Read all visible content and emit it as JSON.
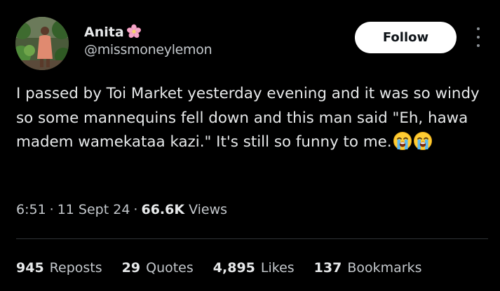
{
  "author": {
    "display_name": "Anita",
    "name_icon": "pink-flower-icon",
    "handle": "@missmoneylemon",
    "avatar_icon": "profile-photo"
  },
  "actions": {
    "follow_label": "Follow",
    "more_icon": "more-vertical-icon"
  },
  "tweet": {
    "text": "I passed by Toi Market yesterday evening and it was so windy so some mannequins fell down and this man said \"Eh, hawa madem wamekataa kazi.\" It's still so funny to me.",
    "emojis": [
      "loudly-crying-face-icon",
      "loudly-crying-face-icon"
    ]
  },
  "meta": {
    "time": "6:51",
    "separator": "·",
    "date": "11 Sept 24",
    "views_count": "66.6K",
    "views_label": "Views"
  },
  "stats": {
    "reposts_count": "945",
    "reposts_label": "Reposts",
    "quotes_count": "29",
    "quotes_label": "Quotes",
    "likes_count": "4,895",
    "likes_label": "Likes",
    "bookmarks_count": "137",
    "bookmarks_label": "Bookmarks"
  },
  "colors": {
    "background": "#000000",
    "primary_text": "#e7e9ea",
    "secondary_text": "#c4c8cc",
    "divider": "#2f3336",
    "follow_bg": "#ffffff",
    "follow_text": "#0f1419"
  }
}
